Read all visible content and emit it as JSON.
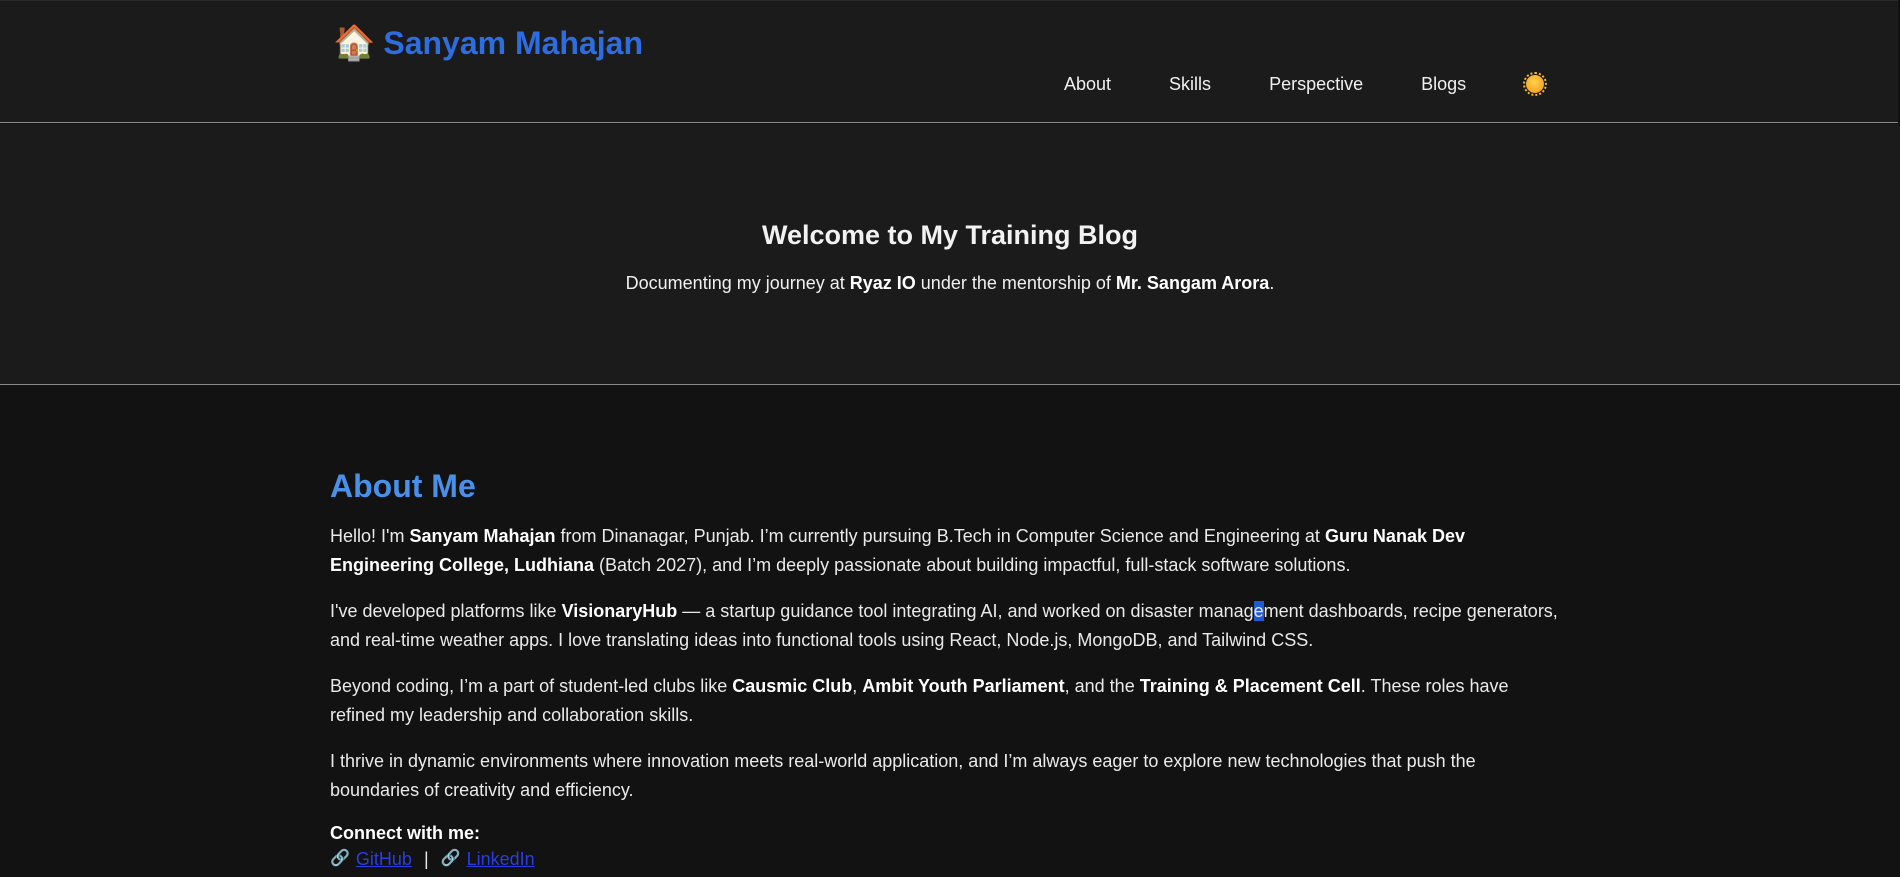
{
  "header": {
    "brand_icon": "🏠",
    "brand_name": "Sanyam Mahajan",
    "nav": [
      "About",
      "Skills",
      "Perspective",
      "Blogs"
    ],
    "theme_toggle_icon": "sun-icon"
  },
  "hero": {
    "title": "Welcome to My Training Blog",
    "sub_pre": "Documenting my journey at ",
    "company": "Ryaz IO",
    "sub_mid": " under the mentorship of ",
    "mentor": "Mr. Sangam Arora",
    "sub_post": "."
  },
  "about": {
    "title": "About Me",
    "p1": {
      "t1": "Hello! I'm ",
      "b1": "Sanyam Mahajan",
      "t2": " from Dinanagar, Punjab. I’m currently pursuing B.Tech in Computer Science and Engineering at ",
      "b2": "Guru Nanak Dev Engineering College, Ludhiana",
      "t3": " (Batch 2027), and I’m deeply passionate about building impactful, full-stack software solutions."
    },
    "p2": {
      "t1": "I've developed platforms like ",
      "b1": "VisionaryHub",
      "t2": " — a startup guidance tool integrating AI, and worked on disaster manag",
      "sel": "e",
      "t3": "ment dashboards, recipe generators, and real-time weather apps. I love translating ideas into functional tools using React, Node.js, MongoDB, and Tailwind CSS."
    },
    "p3": {
      "t1": "Beyond coding, I’m a part of student-led clubs like ",
      "b1": "Causmic Club",
      "t2": ", ",
      "b2": "Ambit Youth Parliament",
      "t3": ", and the ",
      "b3": "Training & Placement Cell",
      "t4": ". These roles have refined my leadership and collaboration skills."
    },
    "p4": "I thrive in dynamic environments where innovation meets real-world application, and I’m always eager to explore new technologies that push the boundaries of creativity and efficiency.",
    "connect_label": "Connect with me:",
    "links": [
      {
        "icon": "🔗",
        "label": "GitHub"
      },
      {
        "icon": "🔗",
        "label": "LinkedIn"
      }
    ],
    "link_separator": "|"
  },
  "colors": {
    "brand": "#2d6de0",
    "section_title": "#4a90e8",
    "link": "#2a3ee0",
    "background": "#121212",
    "header_bg": "#1b1b1b"
  }
}
